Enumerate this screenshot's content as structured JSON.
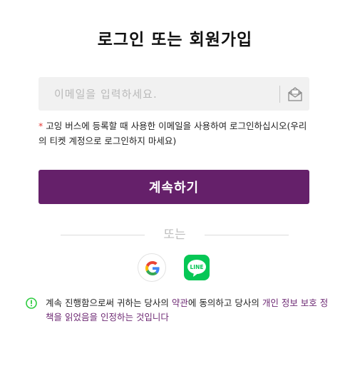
{
  "page_title": "로그인 또는 회원가입",
  "email": {
    "placeholder": "이메일을 입력하세요.",
    "value": "",
    "icon": "mail-icon"
  },
  "notice": {
    "star": "*",
    "text": " 고잉 버스에 등록할 때 사용한 이메일을 사용하여 로그인하십시오(우리의 티켓 계정으로 로그인하지 마세요)"
  },
  "continue_label": "계속하기",
  "divider_text": "또는",
  "social": {
    "google_icon": "google-icon",
    "line_icon": "line-icon",
    "line_text": "LINE"
  },
  "terms": {
    "part1": "계속 진행함으로써 귀하는 당사의 ",
    "link1": "약관",
    "part2": "에 동의하고 당사의 ",
    "link2": "개인 정보 보호 정책",
    "part3": "을 읽었음을 인정하는 것입니다"
  },
  "colors": {
    "primary": "#65206a",
    "star": "#e53935",
    "info": "#2ecc40",
    "line_green": "#06c755",
    "link": "#6e2a74"
  }
}
